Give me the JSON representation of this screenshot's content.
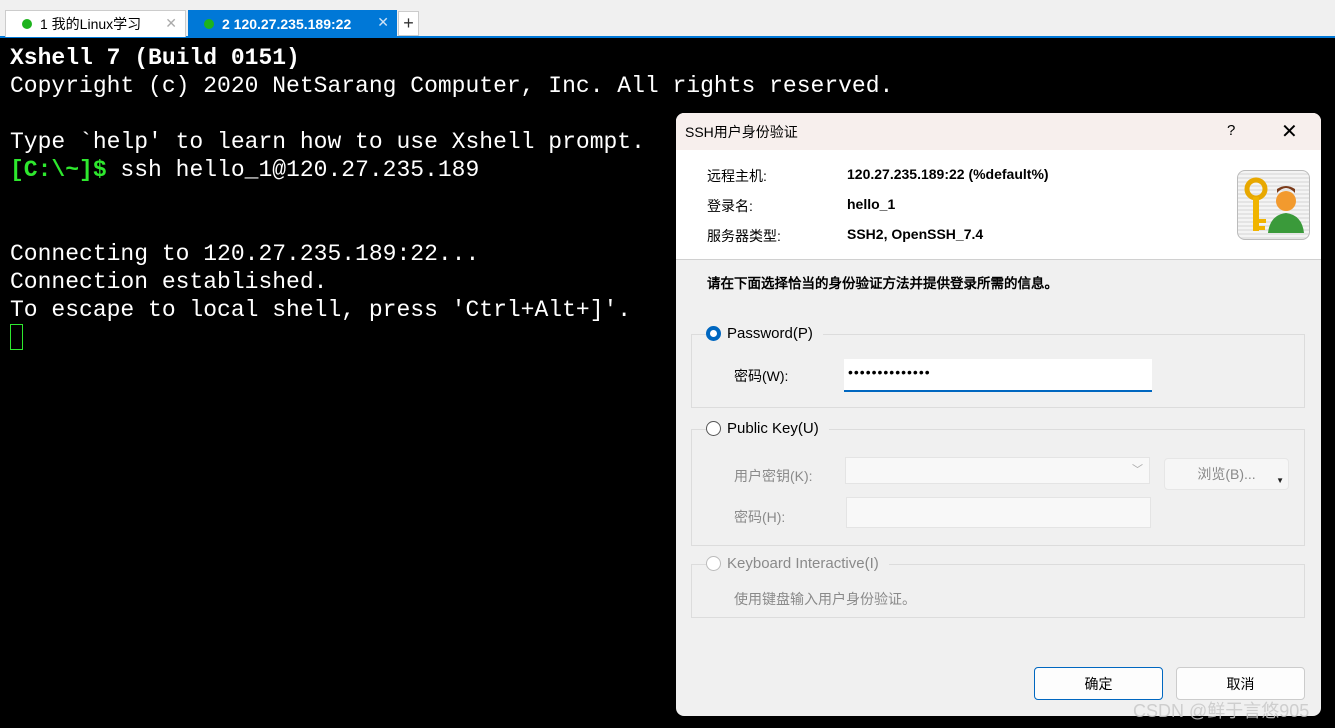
{
  "tabs": [
    {
      "label": "1 我的Linux学习",
      "active": false
    },
    {
      "label": "2 120.27.235.189:22",
      "active": true
    }
  ],
  "terminal": {
    "lines": [
      "Xshell 7 (Build 0151)",
      "Copyright (c) 2020 NetSarang Computer, Inc. All rights reserved.",
      "",
      "Type `help' to learn how to use Xshell prompt.",
      "",
      "",
      "",
      "Connecting to 120.27.235.189:22...",
      "Connection established.",
      "To escape to local shell, press 'Ctrl+Alt+]'."
    ],
    "prompt": "[C:\\~]$",
    "command": " ssh hello_1@120.27.235.189"
  },
  "dialog": {
    "title": "SSH用户身份验证",
    "help": "?",
    "close": "✕",
    "info": [
      {
        "k": "远程主机:",
        "v": "120.27.235.189:22 (%default%)"
      },
      {
        "k": "登录名:",
        "v": "hello_1"
      },
      {
        "k": "服务器类型:",
        "v": "SSH2, OpenSSH_7.4"
      }
    ],
    "instruction": "请在下面选择恰当的身份验证方法并提供登录所需的信息。",
    "password": {
      "label": "Password(P)",
      "selected": true,
      "field_label": "密码(W):",
      "value": "••••••••••••••"
    },
    "publickey": {
      "label": "Public Key(U)",
      "selected": false,
      "key_label": "用户密钥(K):",
      "pass_label": "密码(H):",
      "browse": "浏览(B)..."
    },
    "keyboard": {
      "label": "Keyboard Interactive(I)",
      "selected": false,
      "desc": "使用键盘输入用户身份验证。"
    },
    "ok": "确定",
    "cancel": "取消"
  },
  "watermark": "CSDN @鲜于言悠905",
  "colors": {
    "accent": "#0078d7",
    "prompt": "#2ee82e",
    "terminal_bg": "#000000"
  }
}
